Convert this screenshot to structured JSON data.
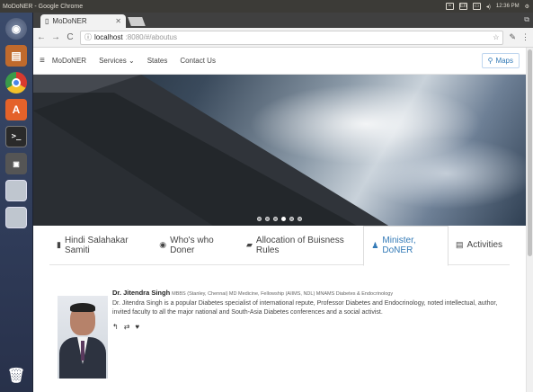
{
  "os": {
    "panel_title": "MoDoNER - Google Chrome",
    "clock": "12:36 PM",
    "lang": "En"
  },
  "browser": {
    "tab_title": "MoDoNER",
    "url_host": "localhost",
    "url_path": ":8080/#/aboutus"
  },
  "navbar": {
    "brand": "MoDoNER",
    "services": "Services",
    "states": "States",
    "contact": "Contact Us",
    "maps": "Maps"
  },
  "carousel": {
    "slide_count": 6,
    "active_index": 3
  },
  "tabs": [
    {
      "label": "Hindi Salahakar Samiti",
      "icon": "book-icon",
      "active": false
    },
    {
      "label": "Who's who Doner",
      "icon": "eye-icon",
      "active": false
    },
    {
      "label": "Allocation of Buisness Rules",
      "icon": "briefcase-icon",
      "active": false
    },
    {
      "label": "Minister, DoNER",
      "icon": "user-icon",
      "active": true
    },
    {
      "label": "Activities",
      "icon": "document-icon",
      "active": false
    }
  ],
  "minister": {
    "name": "Dr. Jitendra Singh",
    "qualifications": "MBBS (Stanley, Chennai) MD Medicine, Fellowship (AIIMS, NDL) MNAMS Diabetes & Endocrinology",
    "description": "Dr. Jitendra Singh is a popular Diabetes specialist of international repute, Professor Diabetes and Endocrinology, noted intellectual, author, invited faculty to all the major national and South-Asia Diabetes conferences and a social activist."
  },
  "colors": {
    "accent": "#337ab7",
    "panel": "#3c3b37",
    "launcher": "#2f3b58"
  }
}
